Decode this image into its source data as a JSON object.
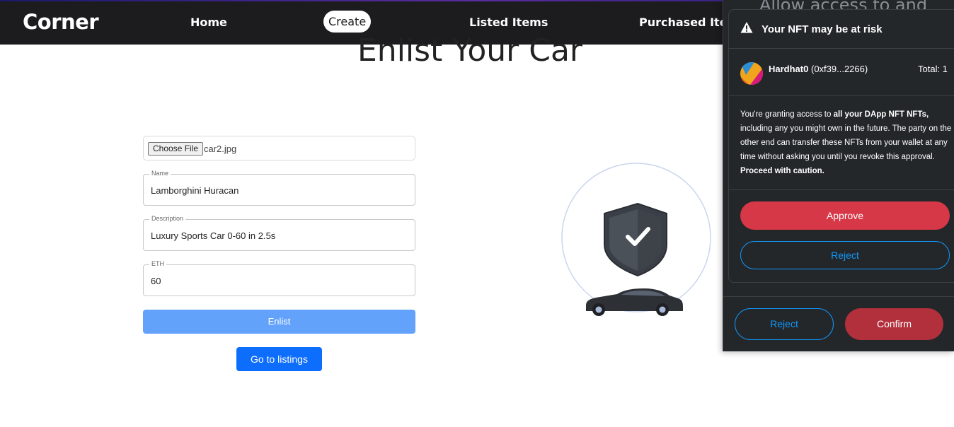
{
  "nav": {
    "brand": "Corner",
    "links": [
      "Home",
      "Create",
      "Listed Items",
      "Purchased Items"
    ]
  },
  "page": {
    "title": "Enlist Your Car"
  },
  "form": {
    "file_button": "Choose File",
    "file_name": "car2.jpg",
    "name_label": "Name",
    "name_value": "Lamborghini Huracan",
    "description_label": "Description",
    "description_value": "Luxury Sports Car 0-60 in 2.5s",
    "eth_label": "ETH",
    "eth_value": "60",
    "enlist_label": "Enlist",
    "listings_label": "Go to listings"
  },
  "wallet": {
    "background_title": "Allow access to and",
    "modal_title": "Your NFT may be at risk",
    "account_name": "Hardhat0",
    "account_address": "(0xf39...2266)",
    "total": "Total: 1",
    "body_part1": "You're granting access to ",
    "body_bold1": "all your DApp NFT NFTs,",
    "body_part2": " including any you might own in the future. The party on the other end can transfer these NFTs from your wallet at any time without asking you until you revoke this approval. ",
    "body_bold2": "Proceed with caution.",
    "approve_label": "Approve",
    "modal_reject_label": "Reject",
    "footer_reject_label": "Reject",
    "confirm_label": "Confirm"
  },
  "colors": {
    "navbar": "#1c1c1f",
    "enlist_button": "#62a2fb",
    "listings_button": "#0d6efd",
    "wallet_bg": "#24272a",
    "approve": "#d73847",
    "confirm": "#b2303c",
    "reject_outline": "#1098fc"
  }
}
